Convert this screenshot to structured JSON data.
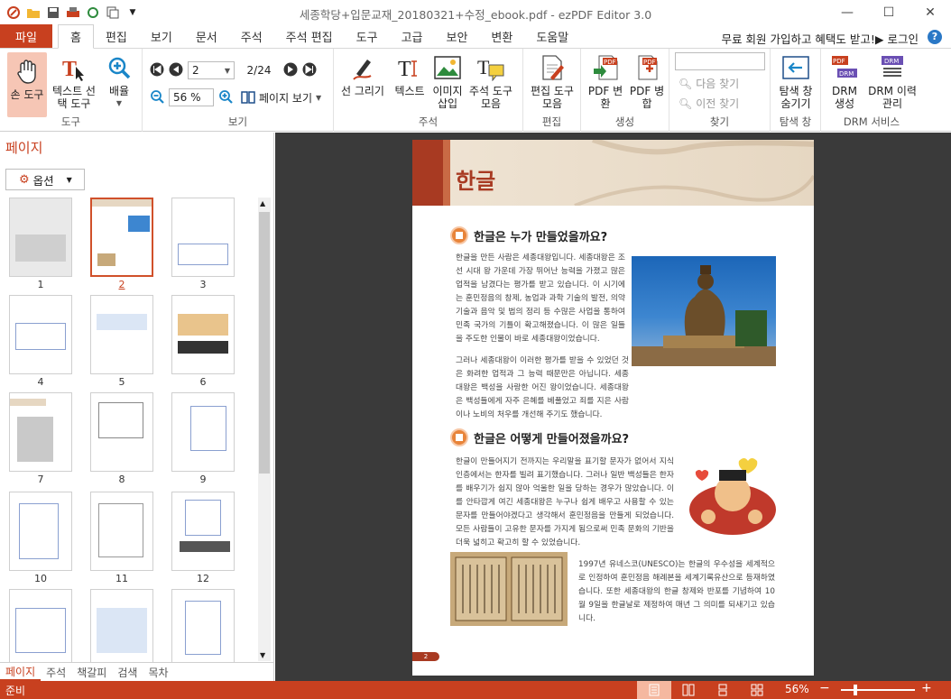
{
  "window": {
    "title": "세종학당+입문교재_20180321+수정_ebook.pdf - ezPDF Editor 3.0",
    "minimize": "—",
    "maximize": "☐",
    "close": "✕"
  },
  "menu": {
    "file": "파일",
    "tabs": [
      "홈",
      "편집",
      "보기",
      "문서",
      "주석",
      "주석 편집",
      "도구",
      "고급",
      "보안",
      "변환",
      "도움말"
    ],
    "promo": "무료 회원 가입하고 혜택도 받고!▶ 로그인",
    "help": "?"
  },
  "ribbon": {
    "tools": {
      "hand": "손 도구",
      "text_select": "텍스트 선택 도구",
      "zoom": "배율",
      "label": "도구"
    },
    "view": {
      "page_value": "2",
      "page_total": "2/24",
      "zoom_value": "56 %",
      "page_view": "페이지 보기",
      "label": "보기"
    },
    "annot": {
      "line": "선 그리기",
      "text": "텍스트",
      "image": "이미지 삽입",
      "annot_tools": "주석 도구 모음",
      "label": "주석"
    },
    "edit": {
      "tools": "편집 도구 모음",
      "label": "편집"
    },
    "create": {
      "convert": "PDF 변환",
      "merge": "PDF 병합",
      "label": "생성"
    },
    "find": {
      "next": "다음 찾기",
      "prev": "이전 찾기",
      "label": "찾기"
    },
    "nav": {
      "hide": "탐색 창 숨기기",
      "label": "탐색 창"
    },
    "drm": {
      "create": "DRM 생성",
      "history": "DRM 이력 관리",
      "label": "DRM 서비스"
    }
  },
  "sidebar": {
    "title": "페이지",
    "options": "옵션",
    "pages": [
      "1",
      "2",
      "3",
      "4",
      "5",
      "6",
      "7",
      "8",
      "9",
      "10",
      "11",
      "12"
    ],
    "selected": "2",
    "tabs": [
      "페이지",
      "주석",
      "책갈피",
      "검색",
      "목차"
    ]
  },
  "doc": {
    "title": "한글",
    "sec1": "한글은 누가 만들었을까요?",
    "p1": "한글을 만든 사람은 세종대왕입니다. 세종대왕은 조선 시대 왕 가운데 가장 뛰어난 능력을 가졌고 많은 업적을 남겼다는 평가를 받고 있습니다. 이 시기에는 훈민정음의 창제, 농업과 과학 기술의 발전, 의약 기술과 음악 및 법의 정리 등 수많은 사업을 통하여 민족 국가의 기틀이 확고해졌습니다. 이 많은 일들을 주도한 인물이 바로 세종대왕이었습니다.",
    "p2": "그러나 세종대왕이 이러한 평가를 받을 수 있었던 것은 화려한 업적과 그 능력 때문만은 아닙니다. 세종대왕은 백성을 사랑한 어진 왕이었습니다. 세종대왕은 백성들에게 자주 은혜를 베풀었고 죄를 지은 사람이나 노비의 처우를 개선해 주기도 했습니다.",
    "sec2": "한글은 어떻게 만들어졌을까요?",
    "p3": "한글이 만들어지기 전까지는 우리말을 표기할 문자가 없어서 지식인층에서는 한자를 빌려 표기했습니다. 그러나 일반 백성들은 한자를 배우기가 쉽지 않아 억울한 일을 당하는 경우가 많았습니다. 이를 안타깝게 여긴 세종대왕은 누구나 쉽게 배우고 사용할 수 있는 문자를 만들어야겠다고 생각해서 훈민정음을 만들게 되었습니다. 모든 사람들이 고유한 문자를 가지게 됨으로써 민족 문화의 기반을 더욱 넓히고 확고히 할 수 있었습니다.",
    "p4": "1997년 유네스코(UNESCO)는 한글의 우수성을 세계적으로 인정하여 훈민정음 해례본을 세계기록유산으로 등재하였습니다. 또한 세종대왕의 한글 창제와 반포를 기념하여 10월 9일을 한글날로 제정하여 매년 그 의미를 되새기고 있습니다.",
    "page_no": "2"
  },
  "status": {
    "text": "준비",
    "zoom": "56%",
    "minus": "−",
    "plus": "+"
  },
  "colors": {
    "accent": "#c8401f",
    "dark_bg": "#3a3a3a"
  }
}
